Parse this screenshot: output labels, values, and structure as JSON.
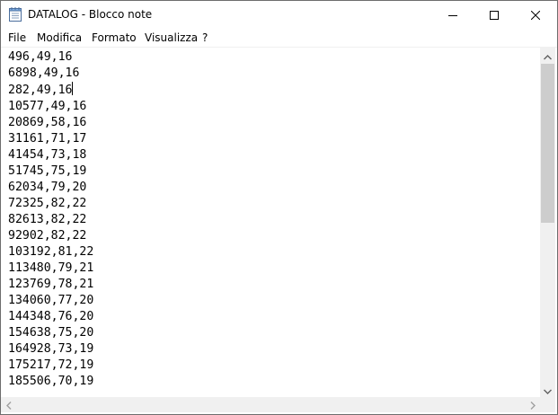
{
  "window": {
    "title": "DATALOG - Blocco note",
    "icon": "notepad-icon"
  },
  "controls": [
    "minimize-icon",
    "maximize-icon",
    "close-icon"
  ],
  "menu": [
    "File",
    "Modifica",
    "Formato",
    "Visualizza",
    "?"
  ],
  "document": {
    "lines": [
      "496,49,16",
      "6898,49,16",
      "282,49,16",
      "10577,49,16",
      "20869,58,16",
      "31161,71,17",
      "41454,73,18",
      "51745,75,19",
      "62034,79,20",
      "72325,82,22",
      "82613,82,22",
      "92902,82,22",
      "103192,81,22",
      "113480,79,21",
      "123769,78,21",
      "134060,77,20",
      "144348,76,20",
      "154638,75,20",
      "164928,73,19",
      "175217,72,19",
      "185506,70,19"
    ],
    "caret_line": 3
  }
}
